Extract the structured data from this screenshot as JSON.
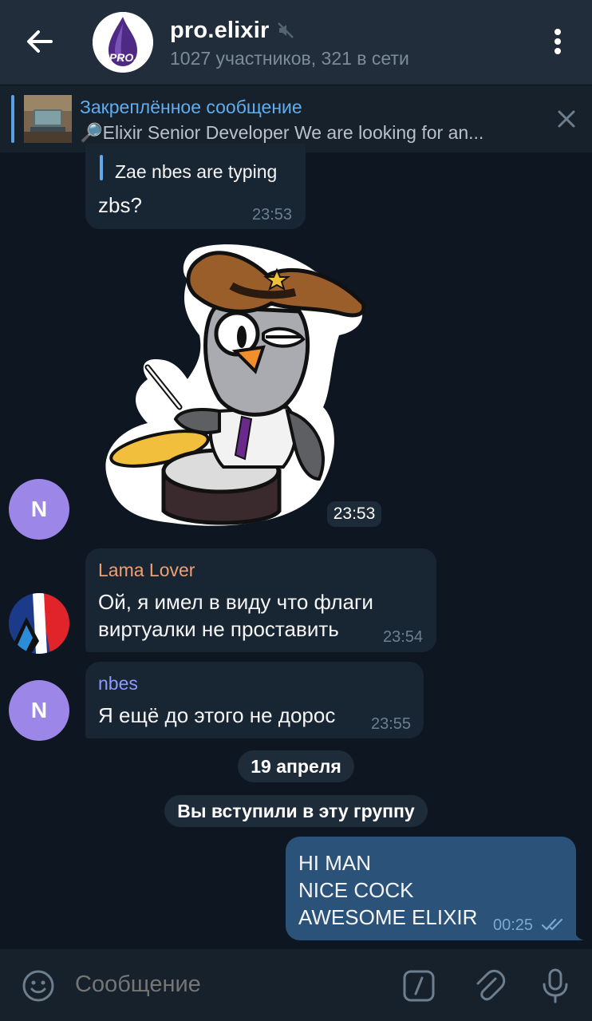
{
  "header": {
    "title": "pro.elixir",
    "subtitle": "1027 участников, 321 в сети",
    "avatar_text": "PRO."
  },
  "pinned": {
    "title": "Закреплённое сообщение",
    "text": "🔎Elixir Senior Developer  We are looking for an..."
  },
  "messages": {
    "first": {
      "reply_text": "Zae nbes are typing",
      "text": "zbs?",
      "time": "23:53"
    },
    "sticker": {
      "time": "23:53",
      "avatar_letter": "N"
    },
    "lama": {
      "sender": "Lama Lover",
      "text": "Ой, я имел в виду что флаги\nвиртуалки не проставить",
      "time": "23:54"
    },
    "nbes": {
      "sender": "nbes",
      "text": "Я ещё до этого не дорос",
      "time": "23:55",
      "avatar_letter": "N"
    },
    "date_pill": "19 апреля",
    "service_pill": "Вы вступили в эту группу",
    "outgoing": {
      "text": "HI MAN\nNICE COCK\nAWESOME ELIXIR",
      "time": "00:25"
    }
  },
  "composer": {
    "placeholder": "Сообщение"
  },
  "colors": {
    "background": "#0e1621",
    "header": "#212d3b",
    "bubble_in": "#182533",
    "bubble_out": "#2b5278",
    "accent": "#5fadf0",
    "lama_name": "#f0a070",
    "nbes_name": "#8e99ff",
    "avatar_n": "#9c87e8"
  },
  "icons": [
    "back-arrow-icon",
    "mute-icon",
    "more-vert-icon",
    "close-icon",
    "emoji-icon",
    "bot-command-icon",
    "attach-icon",
    "mic-icon",
    "read-checks-icon"
  ]
}
